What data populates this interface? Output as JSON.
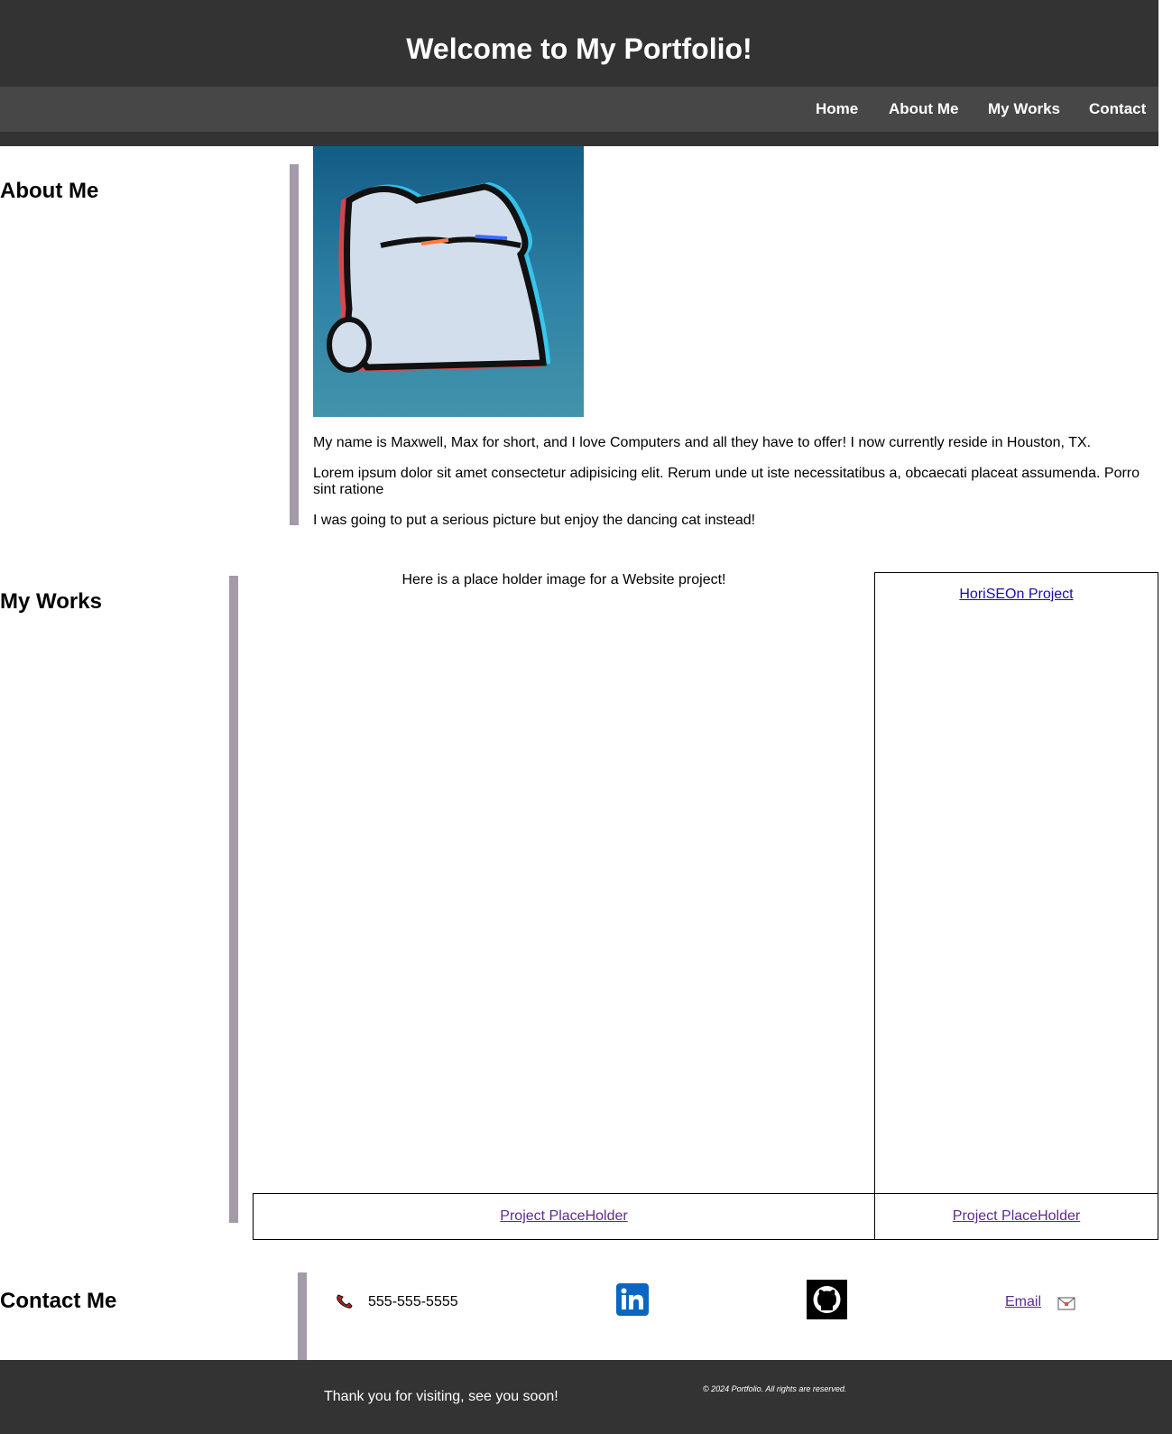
{
  "header": {
    "title": "Welcome to My Portfolio!",
    "nav": [
      "Home",
      "About Me",
      "My Works",
      "Contact"
    ]
  },
  "about": {
    "heading": "About Me",
    "image_description_icon": "dancing-cat-image",
    "paragraphs": [
      "My name is Maxwell, Max for short, and I love Computers and all they have to offer! I now currently reside in Houston, TX.",
      "Lorem ipsum dolor sit amet consectetur adipisicing elit. Rerum unde ut iste necessitatibus a, obcaecati placeat assumenda. Porro sint ratione",
      "I was going to put a serious picture but enjoy the dancing cat instead!"
    ]
  },
  "works": {
    "heading": "My Works",
    "caption": "Here is a place holder image for a Website project!",
    "featured_link": "HoriSEOn Project",
    "placeholder_links": [
      "Project PlaceHolder",
      "Project PlaceHolder"
    ]
  },
  "contact": {
    "heading": "Contact Me",
    "phone_icon": "phone-icon",
    "phone": "555-555-5555",
    "linkedin_icon": "linkedin-icon",
    "github_icon": "github-icon",
    "email_label": "Email",
    "email_icon": "envelope-icon"
  },
  "footer": {
    "thanks": "Thank you for visiting, see you soon!",
    "copyright": "© 2024 Portfolio. All rights are reserved."
  },
  "colors": {
    "header_bg": "#333333",
    "nav_bg": "#474747",
    "side_bar": "#a39ba8",
    "visited_link": "#5b2d8e",
    "link": "#1a0dab"
  }
}
